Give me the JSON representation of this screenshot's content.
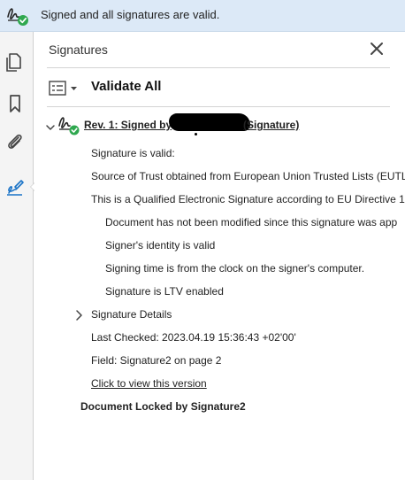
{
  "banner": {
    "text": "Signed and all signatures are valid.",
    "icon": "signature-valid-icon"
  },
  "rail": {
    "items": [
      {
        "icon": "pages-icon"
      },
      {
        "icon": "bookmark-icon"
      },
      {
        "icon": "attachment-icon"
      },
      {
        "icon": "signature-pen-icon",
        "active": true
      }
    ]
  },
  "panel": {
    "title": "Signatures",
    "validate_all_label": "Validate All",
    "revision": {
      "label_prefix": "Rev. 1: Signed by",
      "label_suffix": "(Signature)",
      "details": {
        "valid": "Signature is valid:",
        "trust_source": "Source of Trust obtained from European Union Trusted Lists (EUTL",
        "qualified": "This is a Qualified Electronic Signature according to EU Directive 1",
        "not_modified": "Document has not been modified since this signature was app",
        "identity_valid": "Signer's identity is valid",
        "signing_time": "Signing time is from the clock on the signer's computer.",
        "ltv": "Signature is LTV enabled",
        "signature_details": "Signature Details",
        "last_checked": "Last Checked: 2023.04.19 15:36:43 +02'00'",
        "field": "Field: Signature2 on page 2",
        "view_version": "Click to view this version"
      }
    },
    "locked": "Document Locked by Signature2"
  },
  "colors": {
    "banner_bg": "#dce9f7",
    "accent_blue": "#1a73c7",
    "valid_green": "#2fa84f"
  }
}
